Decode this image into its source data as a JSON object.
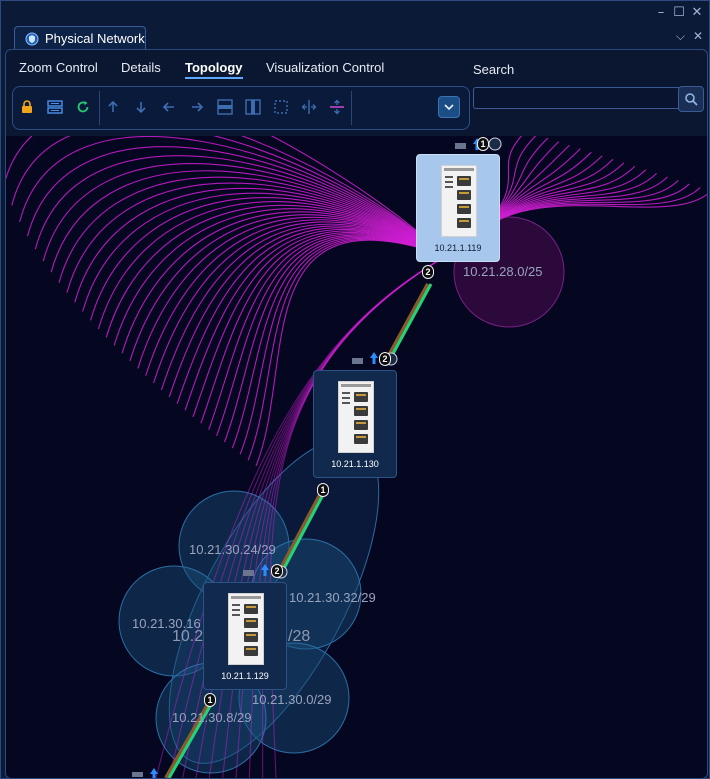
{
  "window": {
    "tab_title": "Physical Network",
    "controls": [
      "minimize-icon",
      "maximize-icon",
      "close-icon"
    ],
    "tab_controls": [
      "chevron-down-icon",
      "close-icon"
    ]
  },
  "menu": {
    "items": [
      "Zoom Control",
      "Details",
      "Topology",
      "Visualization Control"
    ],
    "active": "Topology"
  },
  "toolbar": {
    "icons": [
      "lock-icon",
      "layout-icon",
      "refresh-icon",
      "arrow-up-icon",
      "arrow-down-icon",
      "arrow-left-icon",
      "arrow-right-icon",
      "align-horizontal-icon",
      "align-vertical-icon",
      "select-area-icon",
      "distribute-horizontal-icon",
      "distribute-vertical-icon"
    ],
    "dropdown_icon": "chevron-down-icon"
  },
  "search": {
    "label": "Search",
    "placeholder": "",
    "value": "",
    "button_icon": "search-icon"
  },
  "topology": {
    "devices": [
      {
        "ip": "10.21.1.119",
        "selected": true
      },
      {
        "ip": "10.21.1.130",
        "selected": false
      },
      {
        "ip": "10.21.1.129",
        "selected": false
      }
    ],
    "subnets": [
      "10.21.28.0/25",
      "10.21.30.24/29",
      "10.21.30.32/29",
      "10.21.30.16",
      "/28",
      "10.21.30.0/29",
      "10.21.30.8/29",
      "10.2"
    ],
    "ports": [
      "1",
      "2",
      "2",
      "1",
      "2",
      "1"
    ],
    "colors": {
      "background": "#05061f",
      "fan_links": "#d21fd6",
      "uplink": "#1fd47a",
      "subnet_fill": "#1a4f7a",
      "selected_device": "#a7c8ec",
      "device": "#10294c"
    }
  }
}
